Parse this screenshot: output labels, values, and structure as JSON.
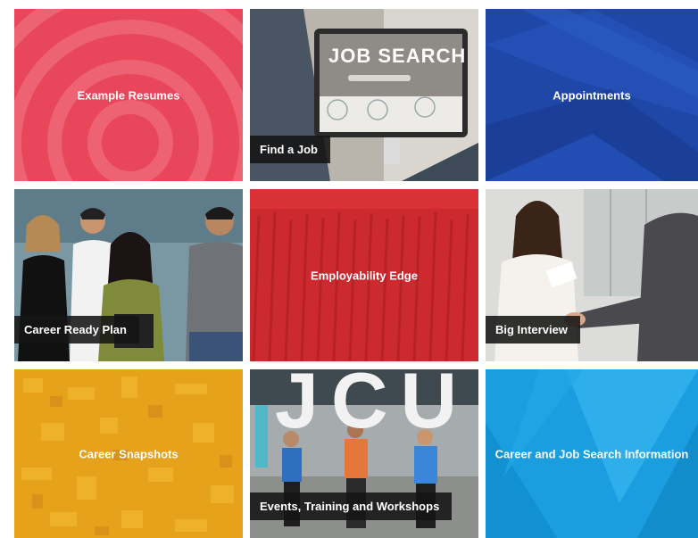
{
  "tiles": [
    {
      "label": "Example Resumes"
    },
    {
      "label": "Find a Job"
    },
    {
      "label": "Appointments"
    },
    {
      "label": "Career Ready Plan"
    },
    {
      "label": "Employability Edge"
    },
    {
      "label": "Big Interview"
    },
    {
      "label": "Career Snapshots"
    },
    {
      "label": "Events, Training and Workshops"
    },
    {
      "label": "Career and Job Search Information"
    }
  ],
  "images": {
    "job_search_screen_text": "JOB SEARCH",
    "campus_letters": "JCU"
  },
  "colors": {
    "resumes": "#e8465a",
    "appointments": "#1f47a8",
    "employability": "#cc2a2e",
    "snapshots": "#e7a21c",
    "career_info": "#1a9ee0",
    "label_bg": "#1a1a1a"
  }
}
